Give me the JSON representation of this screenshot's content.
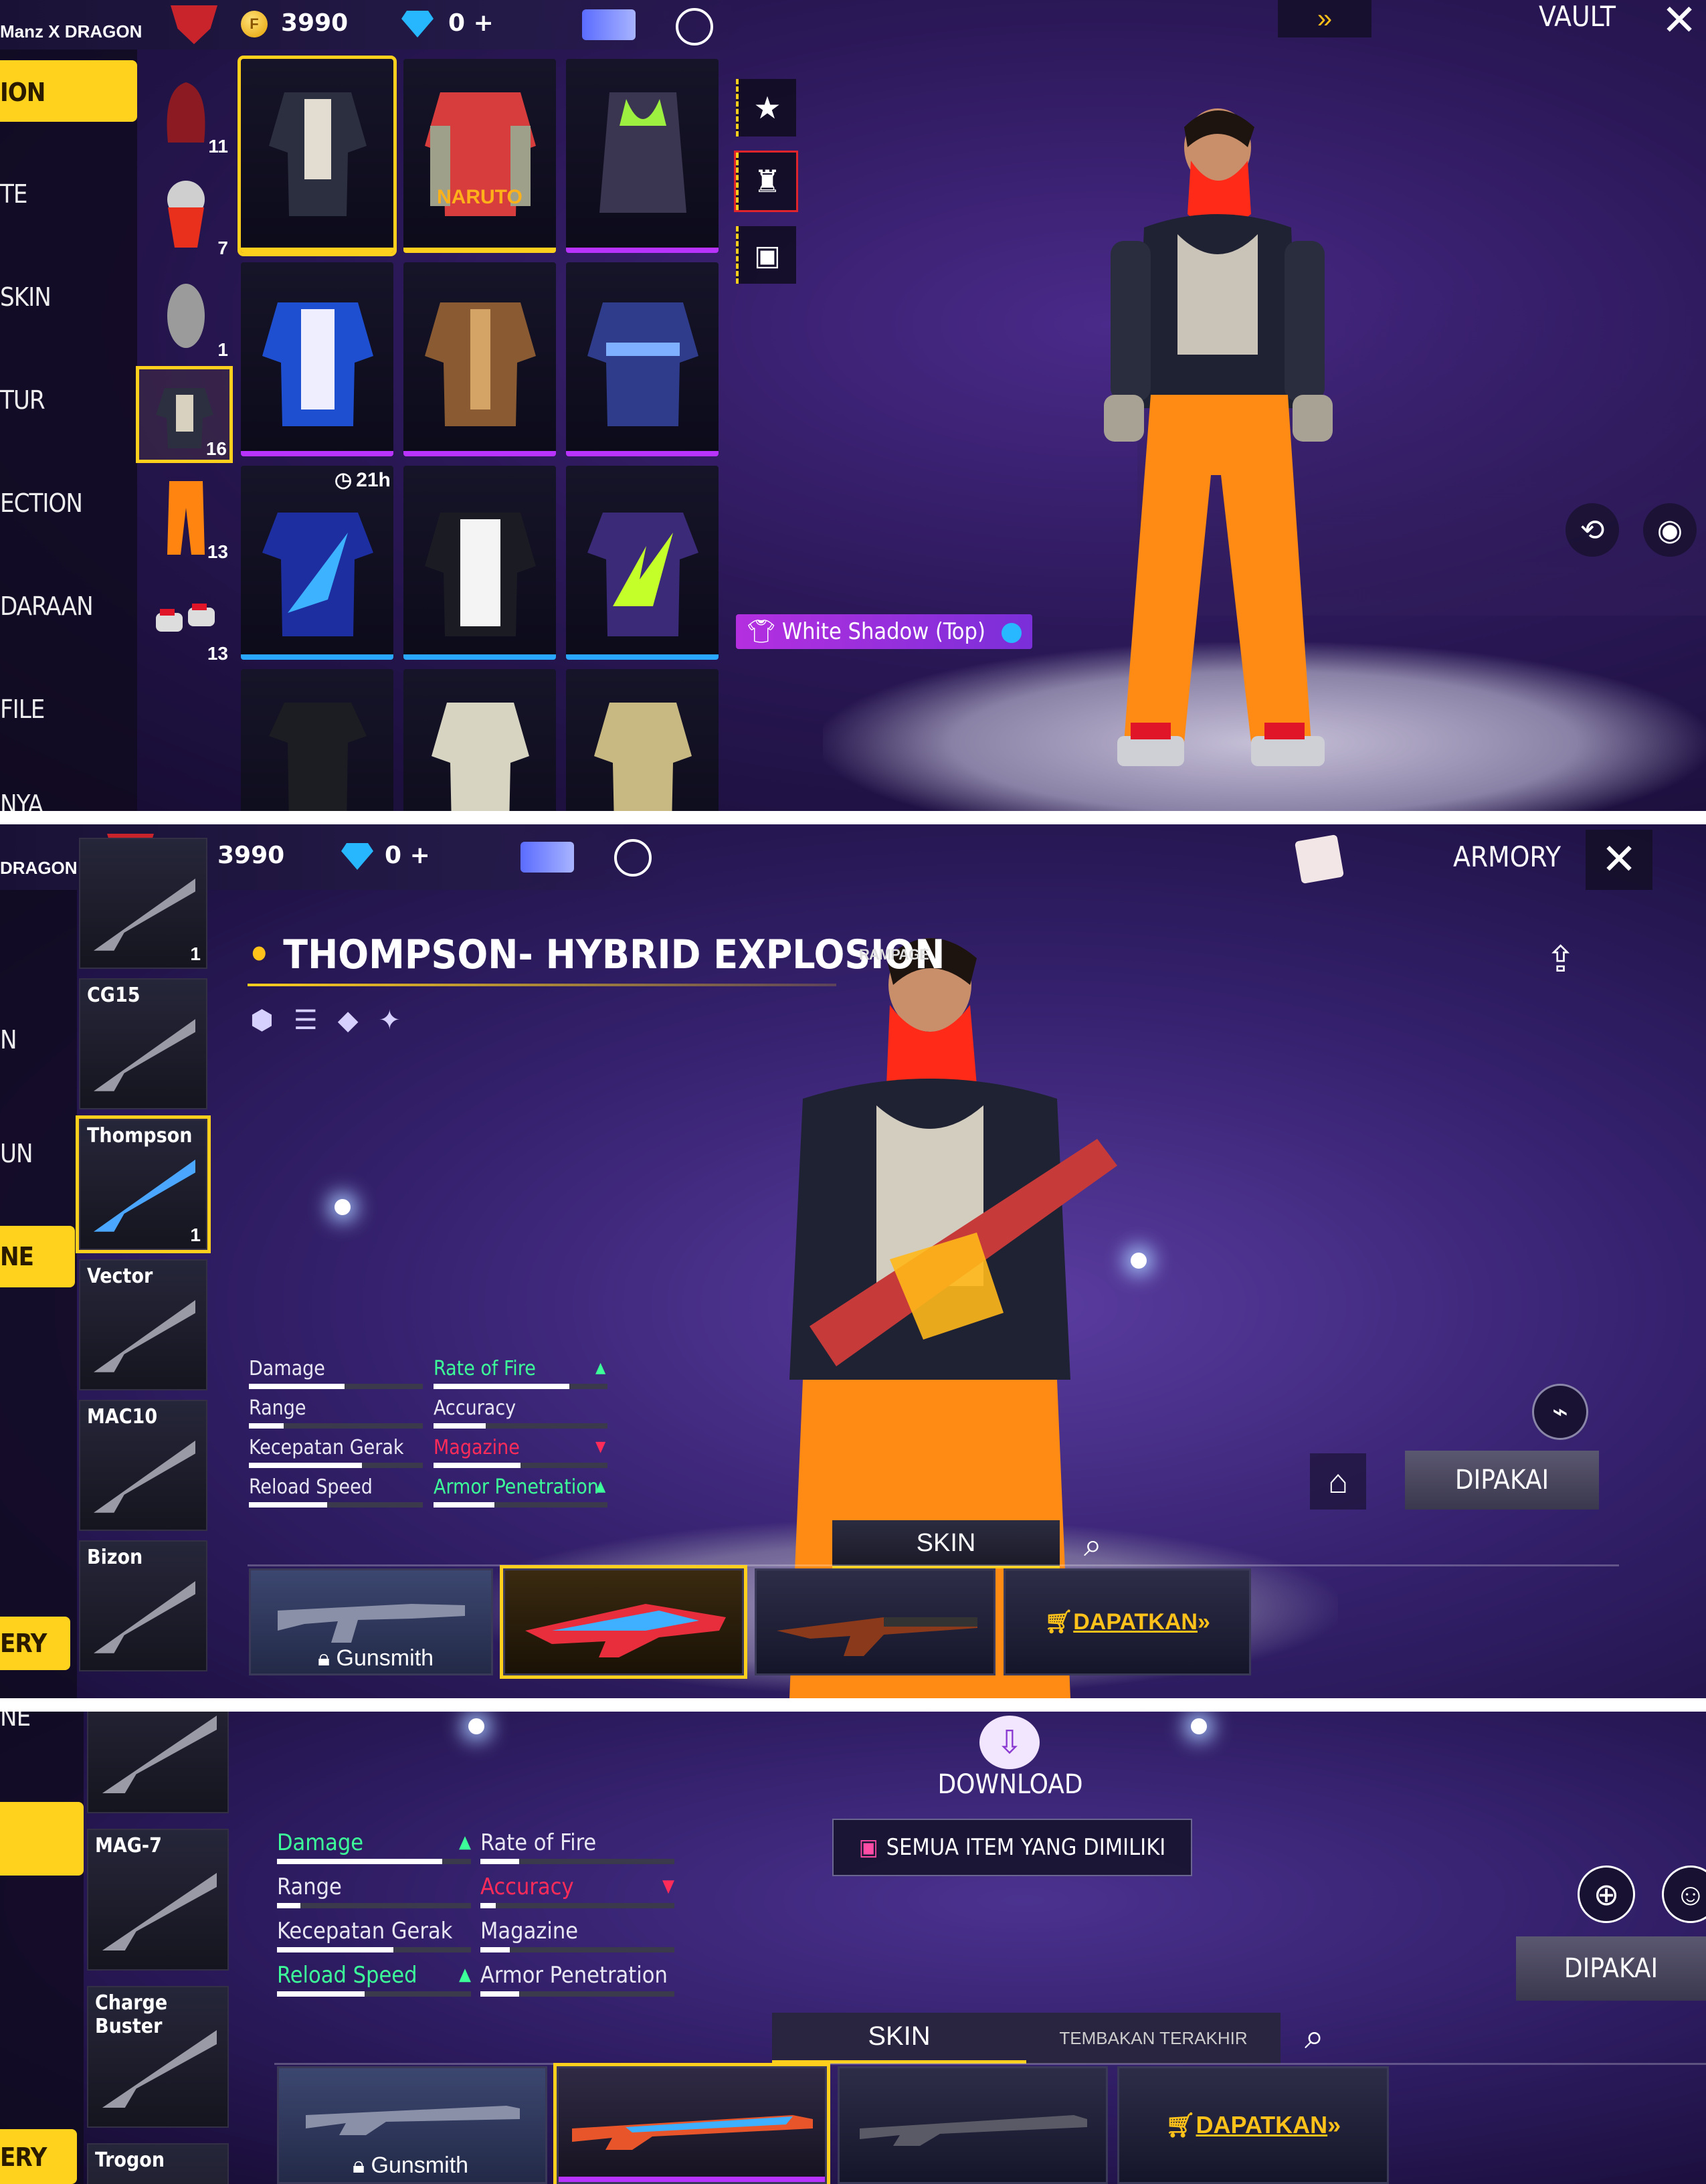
{
  "colors": {
    "accent_yellow": "#ffd21e",
    "purple_rarity": "#b933ff",
    "blue_rarity": "#2aa7ff",
    "green_stat": "#3dff9a",
    "red_stat": "#ff2c5a"
  },
  "panel1": {
    "topbar": {
      "player_name": "Manz X DRAGON",
      "gold": "3990",
      "diamonds": "0 +",
      "section": "VAULT"
    },
    "sidenav": [
      "ION",
      "TE",
      "SKIN",
      "TUR",
      "ECTION",
      "DARAAN",
      "FILE",
      "NYA"
    ],
    "categories": [
      {
        "icon": "hood-icon",
        "count": "11"
      },
      {
        "icon": "mask-icon",
        "count": "7"
      },
      {
        "icon": "face-icon",
        "count": "1"
      },
      {
        "icon": "top-icon",
        "count": "16"
      },
      {
        "icon": "pants-icon",
        "count": "13"
      },
      {
        "icon": "shoes-icon",
        "count": "13"
      }
    ],
    "timer": "21h",
    "naruto_label": "NARUTO",
    "equipped_tag": "White Shadow (Top)"
  },
  "panel2": {
    "topbar": {
      "player_name": "DRAGON",
      "gold": "3990",
      "diamonds": "0 +",
      "section": "ARMORY"
    },
    "sidenav": [
      "N",
      "UN",
      "NE",
      "ERY"
    ],
    "weapon_list": [
      {
        "name": "",
        "count": "1"
      },
      {
        "name": "CG15",
        "count": ""
      },
      {
        "name": "Thompson",
        "count": "1"
      },
      {
        "name": "Vector",
        "count": ""
      },
      {
        "name": "MAC10",
        "count": ""
      },
      {
        "name": "Bizon",
        "count": ""
      }
    ],
    "weapon_title": "THOMPSON- HYBRID EXPLOSION",
    "rampage_badge": "RAMPAGE",
    "stats": [
      {
        "label": "Damage",
        "value": 0.55,
        "kind": "normal"
      },
      {
        "label": "Rate of Fire",
        "value": 0.78,
        "kind": "up"
      },
      {
        "label": "Range",
        "value": 0.2,
        "kind": "normal"
      },
      {
        "label": "Accuracy",
        "value": 0.3,
        "kind": "normal"
      },
      {
        "label": "Kecepatan Gerak",
        "value": 0.65,
        "kind": "normal"
      },
      {
        "label": "Magazine",
        "value": 0.5,
        "kind": "down"
      },
      {
        "label": "Reload Speed",
        "value": 0.45,
        "kind": "normal"
      },
      {
        "label": "Armor Penetration",
        "value": 0.35,
        "kind": "up"
      }
    ],
    "equip_button": "DIPAKAI",
    "skin_tab": "SKIN",
    "gunsmith_label": "Gunsmith",
    "get_button": "DAPATKAN"
  },
  "panel3": {
    "download_label": "DOWNLOAD",
    "owned_button": "SEMUA ITEM YANG DIMILIKI",
    "weapon_list": [
      {
        "name": "",
        "count": ""
      },
      {
        "name": "MAG-7",
        "count": ""
      },
      {
        "name": "Charge Buster",
        "count": ""
      },
      {
        "name": "Trogon",
        "count": ""
      }
    ],
    "sidenav": [
      "NE",
      "ERY"
    ],
    "stats": [
      {
        "label": "Damage",
        "value": 0.85,
        "kind": "up"
      },
      {
        "label": "Rate of Fire",
        "value": 0.2,
        "kind": "normal"
      },
      {
        "label": "Range",
        "value": 0.12,
        "kind": "normal"
      },
      {
        "label": "Accuracy",
        "value": 0.08,
        "kind": "down"
      },
      {
        "label": "Kecepatan Gerak",
        "value": 0.6,
        "kind": "normal"
      },
      {
        "label": "Magazine",
        "value": 0.15,
        "kind": "normal"
      },
      {
        "label": "Reload Speed",
        "value": 0.45,
        "kind": "up"
      },
      {
        "label": "Armor Penetration",
        "value": 0.2,
        "kind": "normal"
      }
    ],
    "equip_button": "DIPAKAI",
    "skin_tab": "SKIN",
    "last_shot_tab": "TEMBAKAN TERAKHIR",
    "gunsmith_label": "Gunsmith",
    "get_button": "DAPATKAN"
  }
}
